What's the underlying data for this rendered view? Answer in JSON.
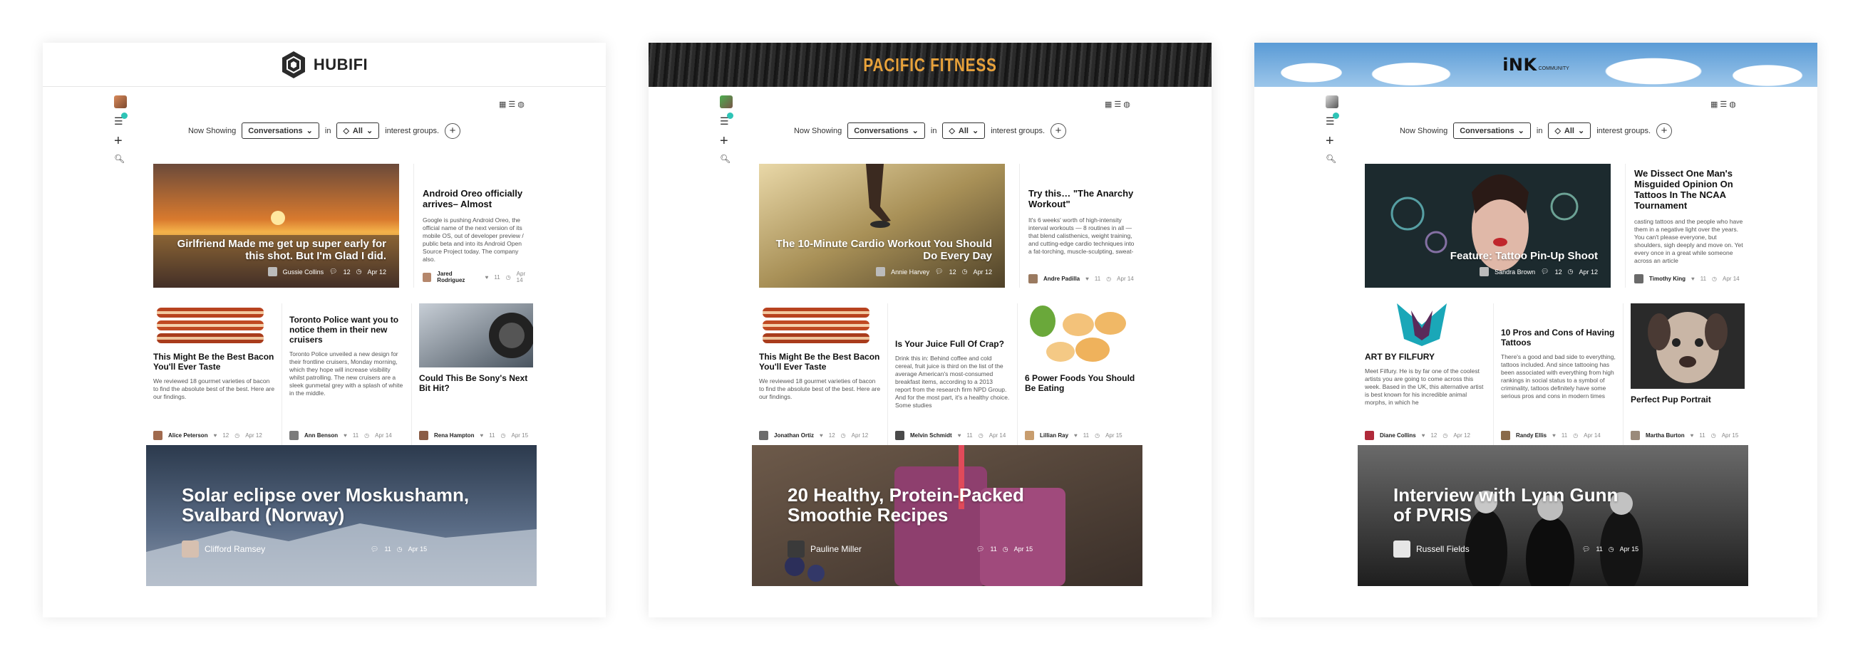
{
  "panels": [
    {
      "brand": "HUBIFI",
      "header_style": "light",
      "filter": {
        "prefix": "Now Showing",
        "type": "Conversations",
        "in": "in",
        "group": "All",
        "suffix": "interest groups."
      },
      "hero": {
        "title": "Girlfriend Made me get up super early for this shot. But I'm Glad I did.",
        "author": "Gussie Collins",
        "comments": "12",
        "date": "Apr 12"
      },
      "side": {
        "title": "Android Oreo officially arrives– Almost",
        "excerpt": "Google is pushing Android Oreo, the official name of the next version of its mobile OS, out of developer preview / public beta and into its Android Open Source Project today. The company also.",
        "author": "Jared Rodriguez",
        "likes": "11",
        "date": "Apr 14"
      },
      "cards": [
        {
          "title": "This Might Be the Best Bacon You'll Ever Taste",
          "excerpt": "We reviewed 18 gourmet varieties of bacon to find the absolute best of the best. Here are our findings.",
          "author": "Alice Peterson",
          "likes": "12",
          "date": "Apr 12"
        },
        {
          "title": "Toronto Police want you to notice them in their new cruisers",
          "excerpt": "Toronto Police unveiled a new design for their frontline cruisers, Monday morning, which they hope will increase visibility whilst patrolling. The new cruisers are a sleek gunmetal grey with a splash of white in the middle.",
          "author": "Ann Benson",
          "likes": "11",
          "date": "Apr 14"
        },
        {
          "title": "Could This Be Sony's Next Bit Hit?",
          "excerpt": "",
          "author": "Rena Hampton",
          "likes": "11",
          "date": "Apr 15"
        }
      ],
      "feature": {
        "title_line1": "Solar eclipse over Moskushamn,",
        "title_line2": "Svalbard (Norway)",
        "author": "Clifford Ramsey",
        "comments": "11",
        "date": "Apr 15"
      }
    },
    {
      "brand": "PACIFIC FITNESS",
      "header_style": "dark",
      "filter": {
        "prefix": "Now Showing",
        "type": "Conversations",
        "in": "in",
        "group": "All",
        "suffix": "interest groups."
      },
      "hero": {
        "title": "The 10-Minute Cardio Workout You Should Do Every Day",
        "author": "Annie Harvey",
        "comments": "12",
        "date": "Apr 12"
      },
      "side": {
        "title": "Try this… \"The Anarchy Workout\"",
        "excerpt": "It's 6 weeks' worth of high-intensity interval workouts — 8 routines in all — that blend calisthenics, weight training, and cutting-edge cardio techniques into a fat-torching, muscle-sculpting, sweat-",
        "author": "Andre Padilla",
        "likes": "11",
        "date": "Apr 14"
      },
      "cards": [
        {
          "title": "This Might Be the Best Bacon You'll Ever Taste",
          "excerpt": "We reviewed 18 gourmet varieties of bacon to find the absolute best of the best. Here are our findings.",
          "author": "Jonathan Ortiz",
          "likes": "12",
          "date": "Apr 12"
        },
        {
          "title": "Is Your Juice Full Of Crap?",
          "excerpt": "Drink this in: Behind coffee and cold cereal, fruit juice is third on the list of the average American's most-consumed breakfast items, according to a 2013 report from the research firm NPD Group. And for the most part, it's a healthy choice. Some studies",
          "author": "Melvin Schmidt",
          "likes": "11",
          "date": "Apr 14"
        },
        {
          "title": "6 Power Foods You Should Be Eating",
          "excerpt": "",
          "author": "Lillian Ray",
          "likes": "11",
          "date": "Apr 15"
        }
      ],
      "feature": {
        "title_line1": "20 Healthy, Protein-Packed",
        "title_line2": "Smoothie Recipes",
        "author": "Pauline Miller",
        "comments": "11",
        "date": "Apr 15"
      }
    },
    {
      "brand": "iNK",
      "brand_sub": "COMMUNITY",
      "header_style": "sky",
      "filter": {
        "prefix": "Now Showing",
        "type": "Conversations",
        "in": "in",
        "group": "All",
        "suffix": "interest groups."
      },
      "hero": {
        "title": "Feature: Tattoo Pin-Up Shoot",
        "author": "Sandra Brown",
        "comments": "12",
        "date": "Apr 12"
      },
      "side": {
        "title": "We Dissect One Man's Misguided Opinion On Tattoos In The NCAA Tournament",
        "excerpt": "casting tattoos and the people who have them in a negative light over the years. You can't please everyone, but shoulders, sigh deeply and move on. Yet every once in a great while someone across an article",
        "author": "Timothy King",
        "likes": "11",
        "date": "Apr 14"
      },
      "cards": [
        {
          "title": "ART BY FILFURY",
          "excerpt": "Meet Filfury. He is by far one of the coolest artists you are going to come across this week. Based in the UK, this alternative artist is best known for his incredible animal morphs, in which he",
          "author": "Diane Collins",
          "likes": "12",
          "date": "Apr 12"
        },
        {
          "title": "10 Pros and Cons of Having Tattoos",
          "excerpt": "There's a good and bad side to everything, tattoos included. And since tattooing has been associated with everything from high rankings in social status to a symbol of criminality, tattoos definitely have some serious pros and cons in modern times",
          "author": "Randy Ellis",
          "likes": "11",
          "date": "Apr 14"
        },
        {
          "title": "Perfect Pup Portrait",
          "excerpt": "",
          "author": "Martha Burton",
          "likes": "11",
          "date": "Apr 15"
        }
      ],
      "feature": {
        "title_line1": "Interview with Lynn Gunn",
        "title_line2": "of PVRIS",
        "author": "Russell Fields",
        "comments": "11",
        "date": "Apr 15"
      }
    }
  ]
}
